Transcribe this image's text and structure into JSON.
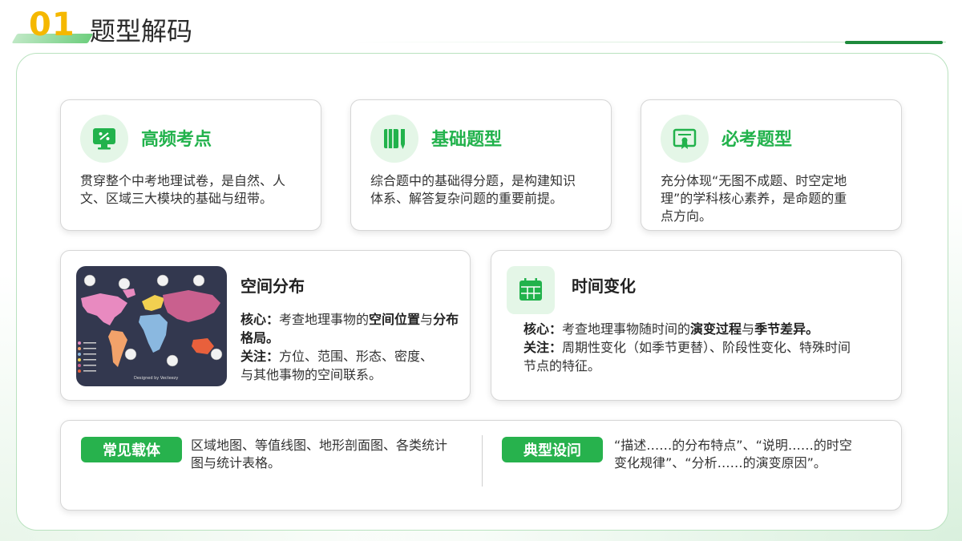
{
  "header": {
    "number": "01",
    "title": "题型解码"
  },
  "cards_top": [
    {
      "title": "高频考点",
      "icon": "presentation-board-icon",
      "text_lines": [
        "贯穿整个中考地理试卷，是自然、人",
        "文、区域三大模块的基础与纽带。"
      ]
    },
    {
      "title": "基础题型",
      "icon": "book-pen-icon",
      "text_lines": [
        "综合题中的基础得分题，是构建知识",
        "体系、解答复杂问题的重要前提。"
      ]
    },
    {
      "title": "必考题型",
      "icon": "certificate-icon",
      "text_lines": [
        "充分体现“无图不成题、时空定地",
        "理”的学科核心素养，是命题的重",
        "点方向。"
      ]
    }
  ],
  "spatial": {
    "title": "空间分布",
    "core_label": "核心：",
    "core_pre": "考查地理事物的",
    "core_bold1": "空间位置",
    "core_mid": "与",
    "core_bold2": "分布格局",
    "core_end": "。",
    "focus_label": "关注：",
    "focus_text_1": "方位、范围、形态、密度、",
    "focus_text_2": "与其他事物的空间联系。",
    "map_credit": "Designed by Vecteezy"
  },
  "temporal": {
    "title": "时间变化",
    "icon": "calendar-icon",
    "core_label": "核心：",
    "core_pre": "考查地理事物随时间的",
    "core_bold1": "演变过程",
    "core_mid": "与",
    "core_bold2": "季节差异",
    "core_end": "。",
    "focus_label": "关注：",
    "focus_text_1": "周期性变化（如季节更替）、阶段性变化、特殊时间",
    "focus_text_2": "节点的特征。"
  },
  "bottom": {
    "carrier_label": "常见载体",
    "carrier_lines": [
      "区域地图、等值线图、地形剖面图、各类统计",
      "图与统计表格。"
    ],
    "design_label": "典型设问",
    "design_lines": [
      "“描述……的分布特点”、“说明……的时空",
      "变化规律”、“分析……的演变原因”。"
    ]
  },
  "colors": {
    "accent_green": "#22b24c",
    "number_yellow": "#f5b800",
    "map_background": "#33384f"
  }
}
